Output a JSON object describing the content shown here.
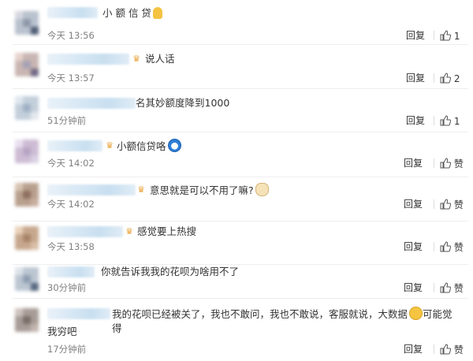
{
  "comments": [
    {
      "text": "小 额 信 贷",
      "emoji": "prayer-emoji",
      "time": "今天 13:56",
      "reply": "回复",
      "likes": "1"
    },
    {
      "text": "说人话",
      "badge": "vip-badge",
      "time": "今天 13:57",
      "reply": "回复",
      "likes": "2"
    },
    {
      "text": "名其妙额度降到1000",
      "time": "51分钟前",
      "reply": "回复",
      "likes": "1"
    },
    {
      "text": "小额信贷咯",
      "emoji": "doraemon-emoji",
      "badge": "vip-badge",
      "time": "今天 14:02",
      "reply": "回复",
      "likes": "赞"
    },
    {
      "text": "意思就是可以不用了嘛?",
      "emoji": "cat-emoji",
      "badge": "vip-badge",
      "time": "今天 14:02",
      "reply": "回复",
      "likes": "赞"
    },
    {
      "text": "感觉要上热搜",
      "badge": "vip-badge",
      "time": "今天 13:58",
      "reply": "回复",
      "likes": "赞"
    },
    {
      "text": "你就告诉我我的花呗为啥用不了",
      "time": "30分钟前",
      "reply": "回复",
      "likes": "赞"
    },
    {
      "text_part1": "我的花呗已经被关了，我也不敢问，我也不敢说，客服就说，大数据",
      "emoji": "smile-emoji",
      "text_part2": "可能觉得",
      "text_line2": "我穷吧",
      "time": "17分钟前",
      "reply": "回复",
      "likes": "赞"
    }
  ],
  "colors": {
    "text": "#333333",
    "time": "#808080",
    "divider": "#eeeeee",
    "username_blur": "#c8dff0",
    "vip_badge": "#e8a33b"
  },
  "icons": {
    "like": "thumbs-up-icon"
  }
}
